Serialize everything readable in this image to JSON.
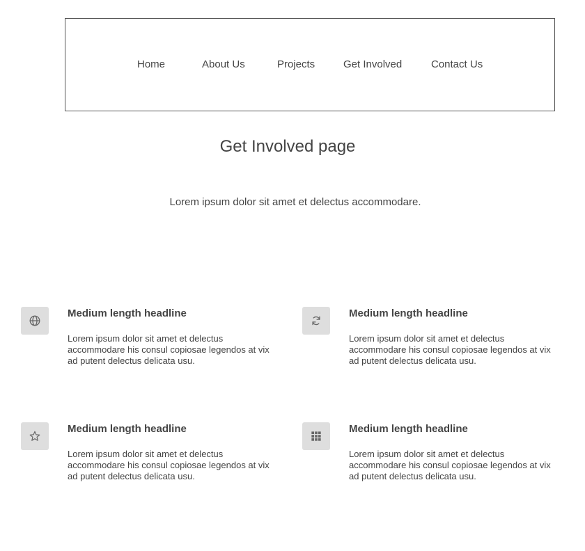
{
  "nav": {
    "items": [
      {
        "label": "Home"
      },
      {
        "label": "About Us"
      },
      {
        "label": "Projects"
      },
      {
        "label": "Get Involved"
      },
      {
        "label": "Contact Us"
      }
    ]
  },
  "main": {
    "title": "Get Involved page",
    "intro": "Lorem ipsum dolor sit amet et delectus accommodare."
  },
  "features": [
    {
      "icon": "globe-icon",
      "headline": "Medium length headline",
      "text": "Lorem ipsum dolor sit amet et delectus accommodare his consul copiosae legendos at vix ad putent delectus delicata usu."
    },
    {
      "icon": "refresh-icon",
      "headline": "Medium length headline",
      "text": "Lorem ipsum dolor sit amet et delectus accommodare his consul copiosae legendos at vix ad putent delectus delicata usu."
    },
    {
      "icon": "star-icon",
      "headline": "Medium length headline",
      "text": "Lorem ipsum dolor sit amet et delectus accommodare his consul copiosae legendos at vix ad putent delectus delicata usu."
    },
    {
      "icon": "grid-icon",
      "headline": "Medium length headline",
      "text": "Lorem ipsum dolor sit amet et delectus accommodare his consul copiosae legendos at vix ad putent delectus delicata usu."
    }
  ],
  "colors": {
    "text": "#444444",
    "icon_bg": "#dedede",
    "icon_fg": "#666666",
    "nav_border": "#555555"
  }
}
